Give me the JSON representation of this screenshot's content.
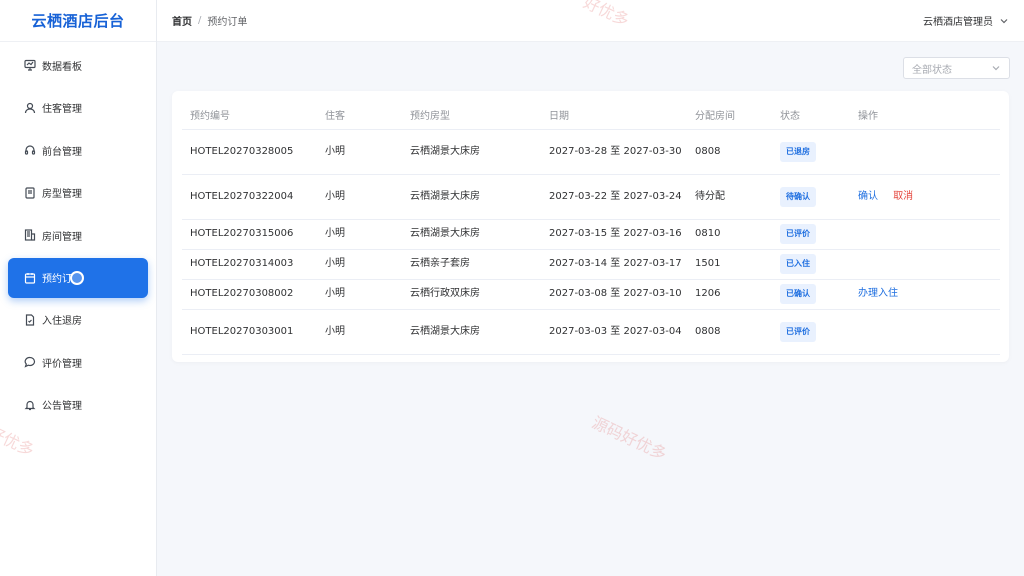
{
  "brand": "云栖酒店后台",
  "sidebar": {
    "items": [
      {
        "label": "数据看板"
      },
      {
        "label": "住客管理"
      },
      {
        "label": "前台管理"
      },
      {
        "label": "房型管理"
      },
      {
        "label": "房间管理"
      },
      {
        "label": "预约订单"
      },
      {
        "label": "入住退房"
      },
      {
        "label": "评价管理"
      },
      {
        "label": "公告管理"
      }
    ],
    "active_label": "预约订"
  },
  "header": {
    "breadcrumb_home": "首页",
    "breadcrumb_sep": "/",
    "breadcrumb_current": "预约订单",
    "user": "云栖酒店管理员"
  },
  "filter": {
    "placeholder": "全部状态"
  },
  "table": {
    "columns": [
      "预约编号",
      "住客",
      "预约房型",
      "日期",
      "分配房间",
      "状态",
      "操作"
    ],
    "rows": [
      {
        "id": "HOTEL20270328005",
        "guest": "小明",
        "room_type": "云栖湖景大床房",
        "date": "2027-03-28 至 2027-03-30",
        "room": "0808",
        "status": "已退房",
        "actions": []
      },
      {
        "id": "HOTEL20270322004",
        "guest": "小明",
        "room_type": "云栖湖景大床房",
        "date": "2027-03-22 至 2027-03-24",
        "room": "待分配",
        "status": "待确认",
        "actions": [
          "确认",
          "取消"
        ]
      },
      {
        "id": "HOTEL20270315006",
        "guest": "小明",
        "room_type": "云栖湖景大床房",
        "date": "2027-03-15 至 2027-03-16",
        "room": "0810",
        "status": "已评价",
        "actions": []
      },
      {
        "id": "HOTEL20270314003",
        "guest": "小明",
        "room_type": "云栖亲子套房",
        "date": "2027-03-14 至 2027-03-17",
        "room": "1501",
        "status": "已入住",
        "actions": []
      },
      {
        "id": "HOTEL20270308002",
        "guest": "小明",
        "room_type": "云栖行政双床房",
        "date": "2027-03-08 至 2027-03-10",
        "room": "1206",
        "status": "已确认",
        "actions": [
          "办理入住"
        ]
      },
      {
        "id": "HOTEL20270303001",
        "guest": "小明",
        "room_type": "云栖湖景大床房",
        "date": "2027-03-03 至 2027-03-04",
        "room": "0808",
        "status": "已评价",
        "actions": []
      }
    ]
  },
  "watermark": [
    "源码好优多",
    "好优多",
    "源码好优多"
  ],
  "colors": {
    "accent": "#1f72e8",
    "danger": "#e5443b",
    "badge_bg": "#e9f1fe"
  }
}
